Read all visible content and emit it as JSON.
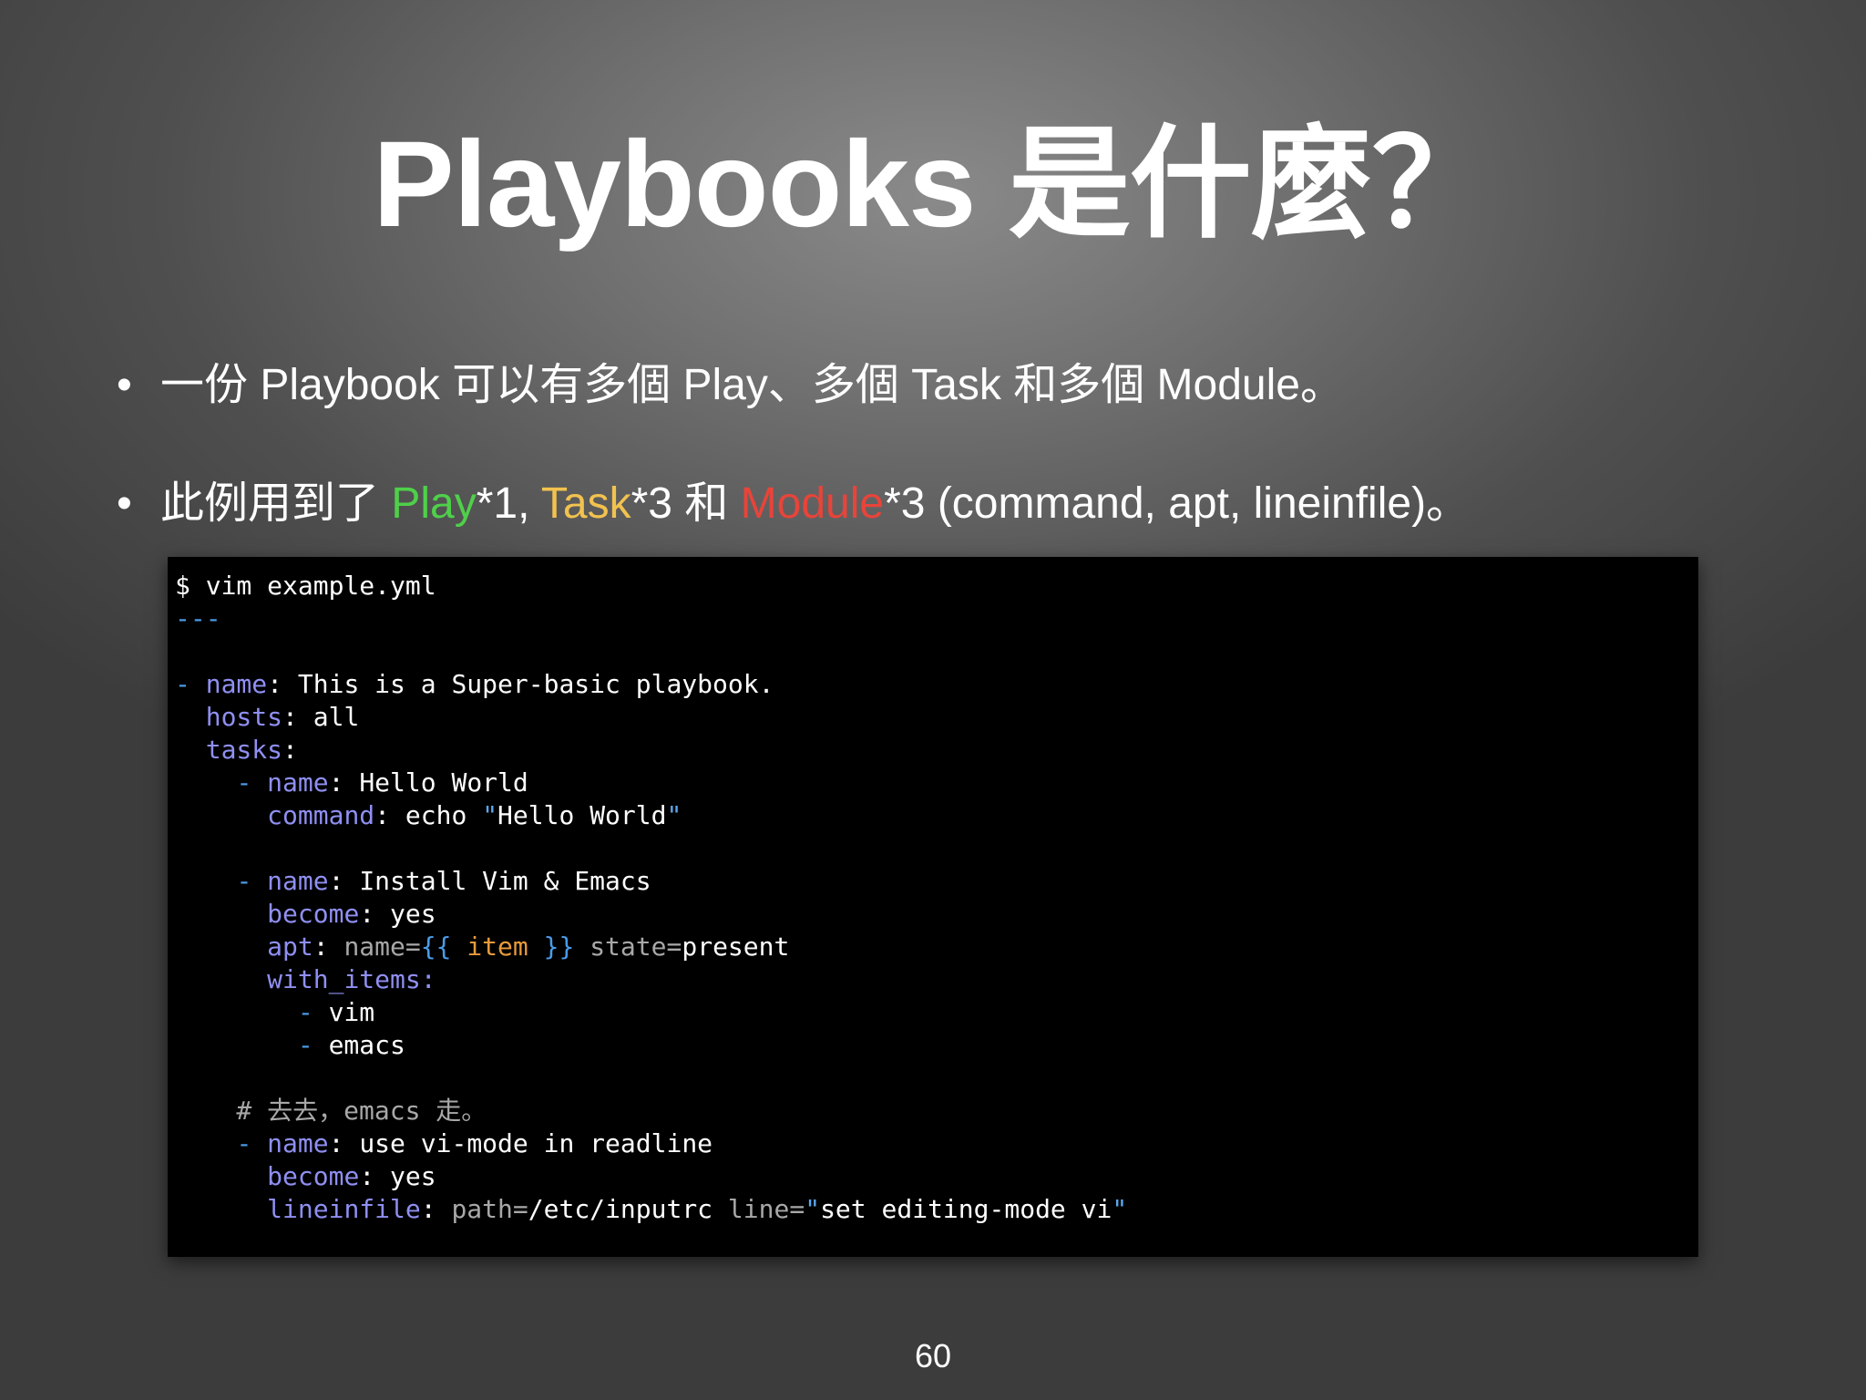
{
  "slide": {
    "title": "Playbooks 是什麼？",
    "page_number": "60"
  },
  "bullets": {
    "b1": {
      "marker": "•",
      "text": "一份 Playbook 可以有多個 Play、多個 Task 和多個 Module。"
    },
    "b2": {
      "marker": "•",
      "prefix": "此例用到了 ",
      "play": "Play",
      "after_play": "*1, ",
      "task": "Task",
      "after_task": "*3 和 ",
      "module": "Module",
      "after_module": "*3 (command, apt, lineinfile)。"
    }
  },
  "colors": {
    "play": "#4fd04a",
    "task": "#f2c24f",
    "module": "#e8443a",
    "code_key": "#8f8ff2",
    "code_dash": "#4a9ce8",
    "code_var": "#e89a3c",
    "code_arg": "#a8a8a8"
  },
  "code": [
    [
      {
        "t": "$ vim example.yml",
        "c": "str"
      }
    ],
    [
      {
        "t": "---",
        "c": "dash"
      }
    ],
    [],
    [
      {
        "t": "- ",
        "c": "dash"
      },
      {
        "t": "name",
        "c": "key"
      },
      {
        "t": ": ",
        "c": "punct"
      },
      {
        "t": "This is a Super-basic playbook.",
        "c": "str"
      }
    ],
    [
      {
        "t": "  ",
        "c": "str"
      },
      {
        "t": "hosts",
        "c": "key"
      },
      {
        "t": ": ",
        "c": "punct"
      },
      {
        "t": "all",
        "c": "str"
      }
    ],
    [
      {
        "t": "  ",
        "c": "str"
      },
      {
        "t": "tasks",
        "c": "key"
      },
      {
        "t": ":",
        "c": "punct"
      }
    ],
    [
      {
        "t": "    ",
        "c": "str"
      },
      {
        "t": "- ",
        "c": "dash"
      },
      {
        "t": "name",
        "c": "key"
      },
      {
        "t": ": ",
        "c": "punct"
      },
      {
        "t": "Hello World",
        "c": "str"
      }
    ],
    [
      {
        "t": "      ",
        "c": "str"
      },
      {
        "t": "command",
        "c": "key"
      },
      {
        "t": ": ",
        "c": "punct"
      },
      {
        "t": "echo ",
        "c": "str"
      },
      {
        "t": "\"",
        "c": "quote"
      },
      {
        "t": "Hello World",
        "c": "str"
      },
      {
        "t": "\"",
        "c": "quote"
      }
    ],
    [],
    [
      {
        "t": "    ",
        "c": "str"
      },
      {
        "t": "- ",
        "c": "dash"
      },
      {
        "t": "name",
        "c": "key"
      },
      {
        "t": ": ",
        "c": "punct"
      },
      {
        "t": "Install Vim & Emacs",
        "c": "str"
      }
    ],
    [
      {
        "t": "      ",
        "c": "str"
      },
      {
        "t": "become",
        "c": "key"
      },
      {
        "t": ": ",
        "c": "punct"
      },
      {
        "t": "yes",
        "c": "str"
      }
    ],
    [
      {
        "t": "      ",
        "c": "str"
      },
      {
        "t": "apt",
        "c": "key"
      },
      {
        "t": ": ",
        "c": "punct"
      },
      {
        "t": "name=",
        "c": "arg"
      },
      {
        "t": "{{ ",
        "c": "brace"
      },
      {
        "t": "item",
        "c": "var"
      },
      {
        "t": " }}",
        "c": "brace"
      },
      {
        "t": " state=",
        "c": "arg"
      },
      {
        "t": "present",
        "c": "str"
      }
    ],
    [
      {
        "t": "      ",
        "c": "str"
      },
      {
        "t": "with_items:",
        "c": "key"
      }
    ],
    [
      {
        "t": "        ",
        "c": "str"
      },
      {
        "t": "- ",
        "c": "dash"
      },
      {
        "t": "vim",
        "c": "str"
      }
    ],
    [
      {
        "t": "        ",
        "c": "str"
      },
      {
        "t": "- ",
        "c": "dash"
      },
      {
        "t": "emacs",
        "c": "str"
      }
    ],
    [],
    [
      {
        "t": "    # 去去，emacs 走。",
        "c": "comment"
      }
    ],
    [
      {
        "t": "    ",
        "c": "str"
      },
      {
        "t": "- ",
        "c": "dash"
      },
      {
        "t": "name",
        "c": "key"
      },
      {
        "t": ": ",
        "c": "punct"
      },
      {
        "t": "use vi-mode in readline",
        "c": "str"
      }
    ],
    [
      {
        "t": "      ",
        "c": "str"
      },
      {
        "t": "become",
        "c": "key"
      },
      {
        "t": ": ",
        "c": "punct"
      },
      {
        "t": "yes",
        "c": "str"
      }
    ],
    [
      {
        "t": "      ",
        "c": "str"
      },
      {
        "t": "lineinfile",
        "c": "key"
      },
      {
        "t": ": ",
        "c": "punct"
      },
      {
        "t": "path=",
        "c": "arg"
      },
      {
        "t": "/etc/inputrc",
        "c": "str"
      },
      {
        "t": " line=",
        "c": "arg"
      },
      {
        "t": "\"",
        "c": "quote"
      },
      {
        "t": "set editing-mode vi",
        "c": "str"
      },
      {
        "t": "\"",
        "c": "quote"
      }
    ]
  ]
}
